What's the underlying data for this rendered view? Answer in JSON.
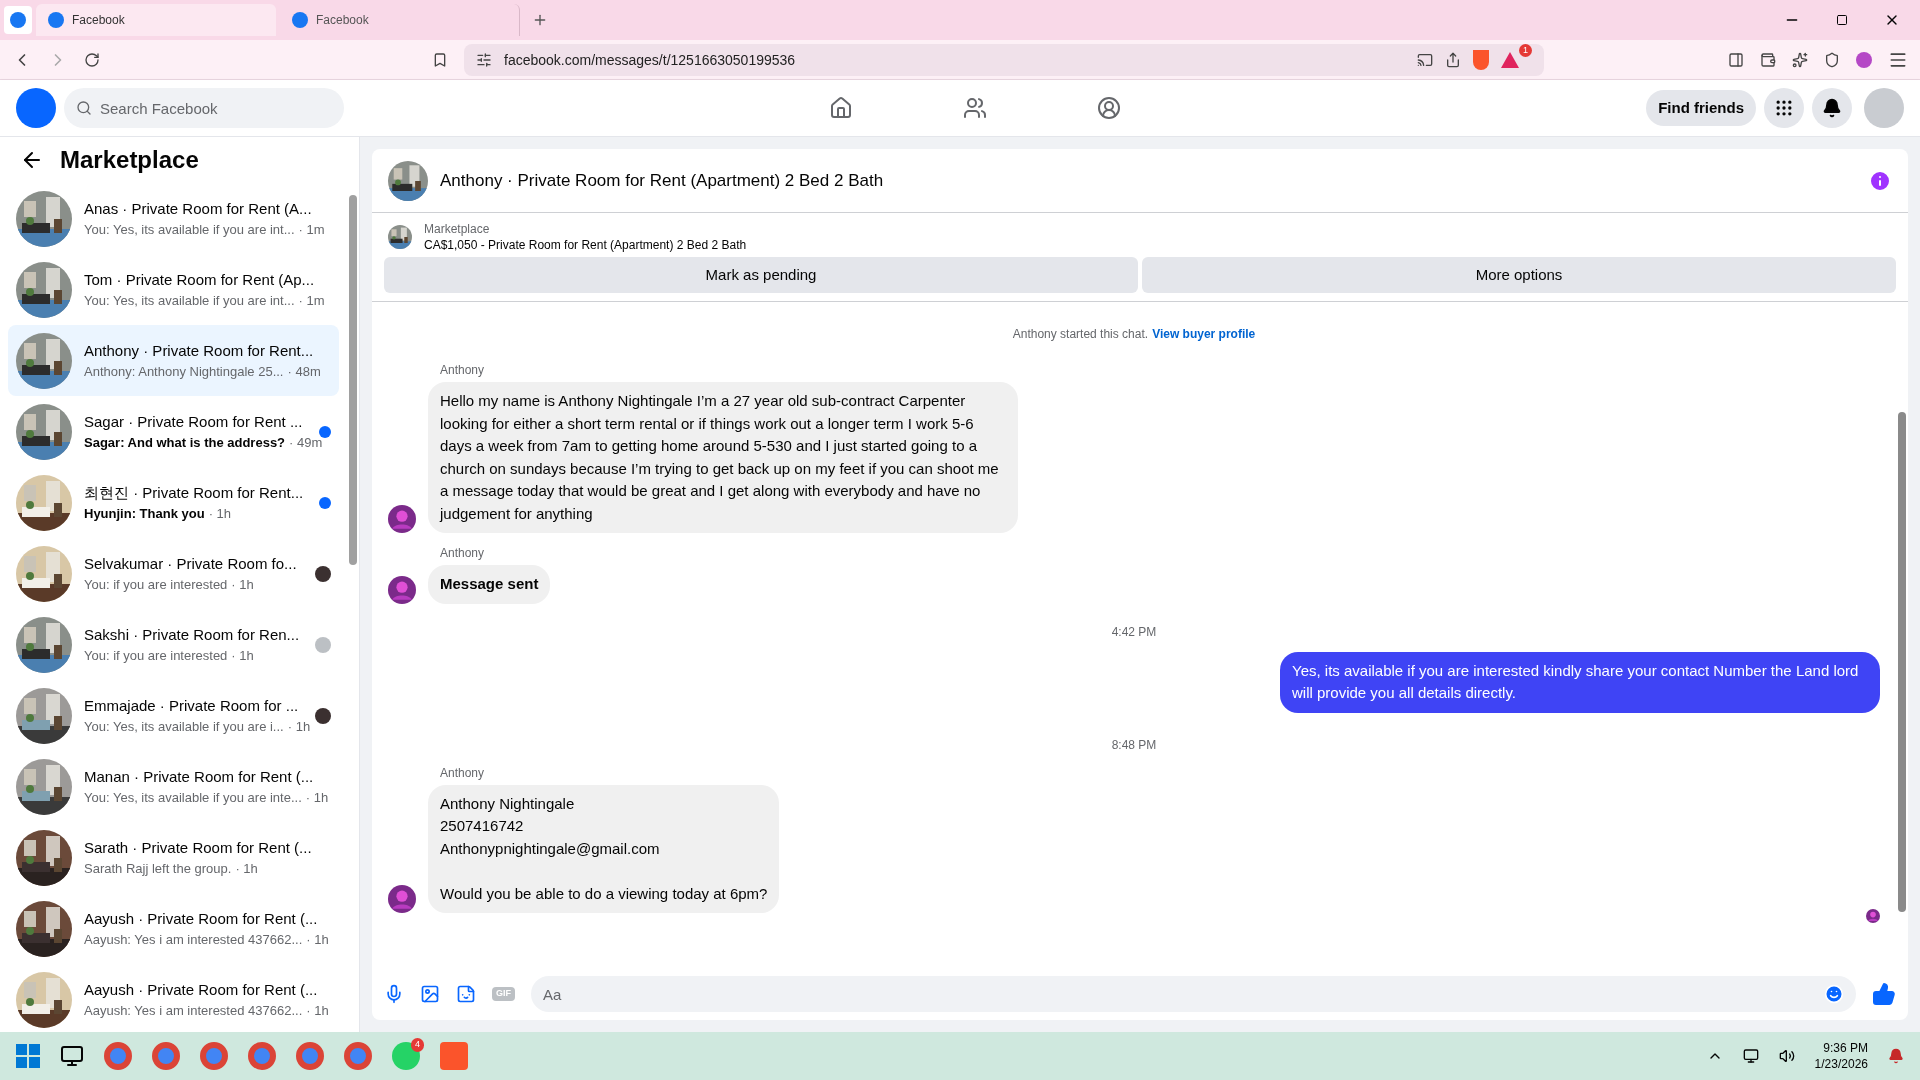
{
  "browser": {
    "tabs": [
      {
        "label": "Facebook",
        "selected": true
      },
      {
        "label": "Facebook",
        "selected": false
      }
    ],
    "url": "facebook.com/messages/t/1251663050199536",
    "rewards_badge": "1"
  },
  "header": {
    "search": {
      "placeholder": "Search Facebook"
    },
    "find_friends": "Find friends"
  },
  "sidebar": {
    "title": "Marketplace",
    "items": [
      {
        "title": "Anas · Private Room for Rent (A...",
        "preview": "You: Yes, its available if you are int...",
        "time": "· 1m",
        "selected": false,
        "kind": "plain"
      },
      {
        "title": "Tom · Private Room for Rent (Ap...",
        "preview": "You: Yes, its available if you are int...",
        "time": "· 1m",
        "selected": false,
        "kind": "plain"
      },
      {
        "title": "Anthony · Private Room for Rent...",
        "preview": "Anthony: Anthony Nightingale 25...",
        "time": "· 48m",
        "selected": true,
        "kind": "plain"
      },
      {
        "title": "Sagar · Private Room for Rent ...",
        "preview": "Sagar: And what is the address?",
        "time": "· 49m",
        "selected": false,
        "kind": "unread"
      },
      {
        "title": "최현진 · Private Room for Rent...",
        "preview": "Hyunjin: Thank you",
        "time": "· 1h",
        "selected": false,
        "kind": "unread"
      },
      {
        "title": "Selvakumar · Private Room fo...",
        "preview": "You: if you are interested",
        "time": "· 1h",
        "selected": false,
        "kind": "seen"
      },
      {
        "title": "Sakshi · Private Room for Ren...",
        "preview": "You: if you are interested",
        "time": "· 1h",
        "selected": false,
        "kind": "seen-default"
      },
      {
        "title": "Emmajade · Private Room for ...",
        "preview": "You: Yes, its available if you are i...",
        "time": "· 1h",
        "selected": false,
        "kind": "seen"
      },
      {
        "title": "Manan · Private Room for Rent (...",
        "preview": "You: Yes, its available if you are inte...",
        "time": "· 1h",
        "selected": false,
        "kind": "plain"
      },
      {
        "title": "Sarath · Private Room for Rent (...",
        "preview": "Sarath Rajj left the group.",
        "time": "· 1h",
        "selected": false,
        "kind": "plain"
      },
      {
        "title": "Aayush · Private Room for Rent (...",
        "preview": "Aayush: Yes i am interested 437662...",
        "time": "· 1h",
        "selected": false,
        "kind": "plain"
      },
      {
        "title": "Aayush · Private Room for Rent (...",
        "preview": "Aayush: Yes i am interested 437662...",
        "time": "· 1h",
        "selected": false,
        "kind": "plain"
      }
    ]
  },
  "chat": {
    "title": "Anthony · Private Room for Rent (Apartment) 2 Bed 2 Bath",
    "listing": {
      "label": "Marketplace",
      "text": "CA$1,050 - Private Room for Rent (Apartment) 2 Bed 2 Bath"
    },
    "actions": [
      "Mark as pending",
      "More options"
    ],
    "messages": [
      {
        "kind": "system",
        "text": "Anthony started this chat.",
        "link": "View buyer profile"
      },
      {
        "kind": "incoming",
        "sender": "Anthony",
        "bold": false,
        "text": "Hello my name is Anthony Nightingale I’m a 27 year old sub-contract Carpenter looking for either a short term rental or if things work out a longer term I work 5-6 days a week from 7am to getting home around 5-530 and I just started going to a church on sundays because I’m trying to get back up on my feet if you can shoot me a message today that would be great and I get along with everybody and have no judgement for anything"
      },
      {
        "kind": "incoming",
        "sender": "Anthony",
        "bold": true,
        "text": "Message sent"
      },
      {
        "kind": "time",
        "text": "4:42 PM"
      },
      {
        "kind": "outgoing",
        "text": "Yes, its available if you are interested kindly share your contact Number the Land lord will provide you all details directly."
      },
      {
        "kind": "time",
        "text": "8:48 PM"
      },
      {
        "kind": "incoming",
        "sender": "Anthony",
        "bold": false,
        "text": "Anthony Nightingale\n2507416742\nAnthonypnightingale@gmail.com\n\nWould you be able to do a viewing today at 6pm?"
      }
    ],
    "composer": {
      "placeholder": "Aa",
      "gif": "GIF"
    }
  },
  "taskbar": {
    "time": "9:36 PM",
    "date": "1/23/2026",
    "whatsapp_badge": "4"
  }
}
